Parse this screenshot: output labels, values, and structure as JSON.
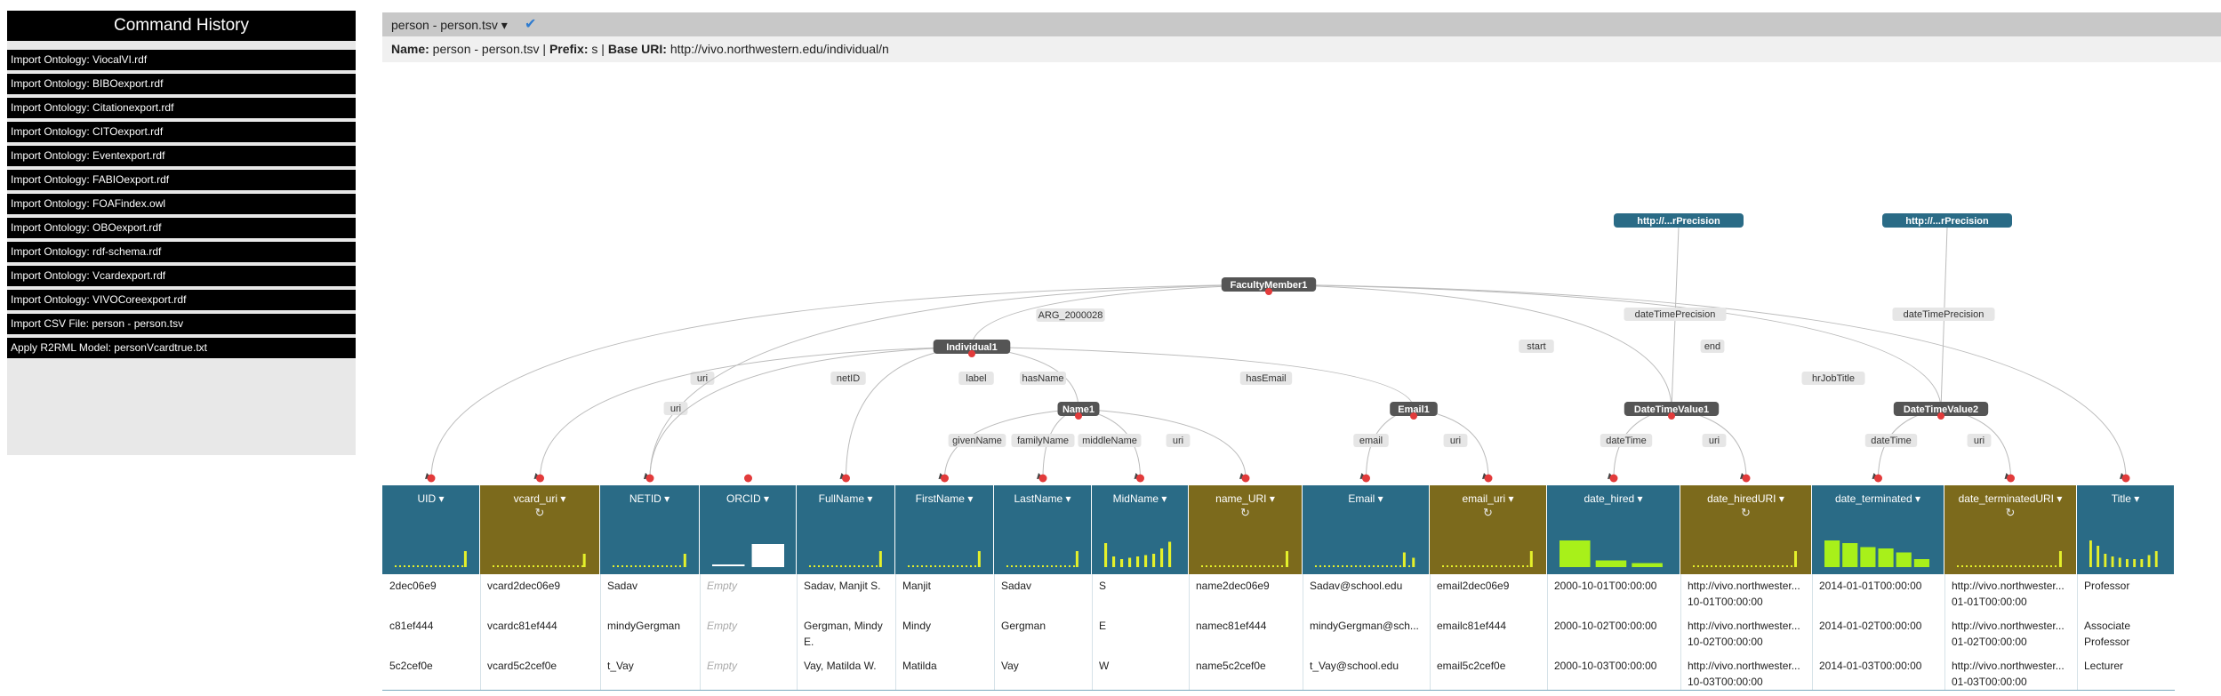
{
  "sidebar": {
    "title": "Command History",
    "commands": [
      "Import Ontology: ViocalVI.rdf",
      "Import Ontology: BIBOexport.rdf",
      "Import Ontology: Citationexport.rdf",
      "Import Ontology: CITOexport.rdf",
      "Import Ontology: Eventexport.rdf",
      "Import Ontology: FABIOexport.rdf",
      "Import Ontology: FOAFindex.owl",
      "Import Ontology: OBOexport.rdf",
      "Import Ontology: rdf-schema.rdf",
      "Import Ontology: Vcardexport.rdf",
      "Import Ontology: VIVOCoreexport.rdf",
      "Import CSV File: person - person.tsv",
      "Apply R2RML Model: personVcardtrue.txt"
    ]
  },
  "worksheet": {
    "tab_label": "person - person.tsv",
    "tab_caret": "▾",
    "check_icon": "✔",
    "name_label": "Name:",
    "name_value": " person - person.tsv | ",
    "prefix_label": "Prefix:",
    "prefix_value": " s | ",
    "base_label": "Base URI:",
    "base_value": " http://vivo.northwestern.edu/individual/n"
  },
  "graph": {
    "nodes": {
      "faculty": "FacultyMember1",
      "individual": "Individual1",
      "name": "Name1",
      "email": "Email1",
      "dtv1": "DateTimeValue1",
      "dtv2": "DateTimeValue2",
      "prec1": "http://...rPrecision",
      "prec2": "http://...rPrecision"
    },
    "edges": {
      "arg": "ARG_2000028",
      "uri_top": "uri",
      "uri_left": "uri",
      "netid": "netID",
      "label": "label",
      "hasname": "hasName",
      "hasemail": "hasEmail",
      "start": "start",
      "end": "end",
      "hrjobtitle": "hrJobTitle",
      "givenname": "givenName",
      "familyname": "familyName",
      "middlename": "middleName",
      "uri_name": "uri",
      "email_edge": "email",
      "uri_email": "uri",
      "datetime1": "dateTime",
      "uri_dtv1": "uri",
      "datetime2": "dateTime",
      "uri_dtv2": "uri",
      "precision1": "dateTimePrecision",
      "precision2": "dateTimePrecision"
    }
  },
  "colors": {
    "header_blue": "#2a6b86",
    "header_olive": "#7c6a1c",
    "histogram": "#e4f02a",
    "histogram_alt": "#a8f01a",
    "node_bg": "#555555",
    "precision_node_bg": "#2a6b86",
    "marker": "#e23b3b"
  },
  "columns": [
    {
      "name": "UID",
      "caret": "▾",
      "style": "blue",
      "refresh": ""
    },
    {
      "name": "vcard_uri",
      "caret": "▾",
      "style": "olive",
      "refresh": "↻"
    },
    {
      "name": "NETID",
      "caret": "▾",
      "style": "blue",
      "refresh": ""
    },
    {
      "name": "ORCID",
      "caret": "▾",
      "style": "blue",
      "refresh": ""
    },
    {
      "name": "FullName",
      "caret": "▾",
      "style": "blue",
      "refresh": ""
    },
    {
      "name": "FirstName",
      "caret": "▾",
      "style": "blue",
      "refresh": ""
    },
    {
      "name": "LastName",
      "caret": "▾",
      "style": "blue",
      "refresh": ""
    },
    {
      "name": "MidName",
      "caret": "▾",
      "style": "blue",
      "refresh": ""
    },
    {
      "name": "name_URI",
      "caret": "▾",
      "style": "olive",
      "refresh": "↻"
    },
    {
      "name": "Email",
      "caret": "▾",
      "style": "blue",
      "refresh": ""
    },
    {
      "name": "email_uri",
      "caret": "▾",
      "style": "olive",
      "refresh": "↻"
    },
    {
      "name": "date_hired",
      "caret": "▾",
      "style": "blue",
      "refresh": ""
    },
    {
      "name": "date_hiredURI",
      "caret": "▾",
      "style": "olive",
      "refresh": "↻"
    },
    {
      "name": "date_terminated",
      "caret": "▾",
      "style": "blue",
      "refresh": ""
    },
    {
      "name": "date_terminatedURI",
      "caret": "▾",
      "style": "olive",
      "refresh": "↻"
    },
    {
      "name": "Title",
      "caret": "▾",
      "style": "blue",
      "refresh": ""
    }
  ],
  "rows": [
    [
      "2dec06e9",
      "vcard2dec06e9",
      "Sadav",
      "Empty",
      "Sadav, Manjit S.",
      "Manjit",
      "Sadav",
      "S",
      "name2dec06e9",
      "Sadav@school.edu",
      "email2dec06e9",
      "2000-10-01T00:00:00",
      "http://vivo.northwester... 10-01T00:00:00",
      "2014-01-01T00:00:00",
      "http://vivo.northwester... 01-01T00:00:00",
      "Professor"
    ],
    [
      "c81ef444",
      "vcardc81ef444",
      "mindyGergman",
      "Empty",
      "Gergman, Mindy E.",
      "Mindy",
      "Gergman",
      "E",
      "namec81ef444",
      "mindyGergman@sch...",
      "emailc81ef444",
      "2000-10-02T00:00:00",
      "http://vivo.northwester... 10-02T00:00:00",
      "2014-01-02T00:00:00",
      "http://vivo.northwester... 01-02T00:00:00",
      "Associate Professor"
    ],
    [
      "5c2cef0e",
      "vcard5c2cef0e",
      "t_Vay",
      "Empty",
      "Vay, Matilda W.",
      "Matilda",
      "Vay",
      "W",
      "name5c2cef0e",
      "t_Vay@school.edu",
      "email5c2cef0e",
      "2000-10-03T00:00:00",
      "http://vivo.northwester... 10-03T00:00:00",
      "2014-01-03T00:00:00",
      "http://vivo.northwester... 01-03T00:00:00",
      "Lecturer"
    ]
  ]
}
